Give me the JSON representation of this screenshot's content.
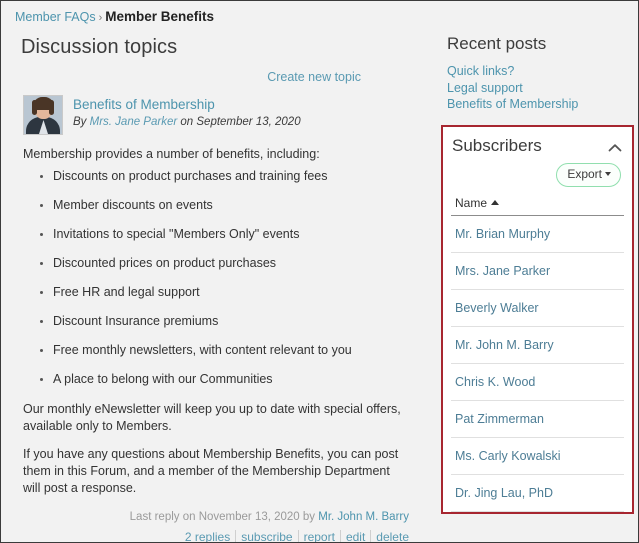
{
  "breadcrumb": {
    "parent": "Member FAQs",
    "separator": "›",
    "current": "Member Benefits"
  },
  "main": {
    "page_title": "Discussion topics",
    "create_topic_label": "Create new topic",
    "topic": {
      "title": "Benefits of Membership",
      "byline_prefix": "By",
      "author": "Mrs. Jane Parker",
      "byline_suffix": "on September 13, 2020",
      "intro": "Membership provides a number of benefits, including:",
      "benefits": [
        "Discounts on product purchases and training fees",
        "Member discounts on events",
        "Invitations to special \"Members Only\" events",
        "Discounted prices on product purchases",
        "Free HR and legal support",
        "Discount Insurance premiums",
        "Free monthly newsletters, with content relevant to you",
        "A place to belong with our Communities"
      ],
      "paragraph_2": "Our monthly eNewsletter will keep you up to date with special offers, available only to Members.",
      "paragraph_3": "If you have any questions about Membership Benefits, you can post them in this Forum, and a member of the Membership Department will post a response.",
      "last_reply_text": "Last reply on November 13, 2020 by",
      "last_reply_author": "Mr. John M. Barry",
      "actions": [
        "2 replies",
        "subscribe",
        "report",
        "edit",
        "delete"
      ]
    }
  },
  "sidebar": {
    "recent_posts": {
      "title": "Recent posts",
      "links": [
        "Quick links?",
        "Legal support",
        "Benefits of Membership"
      ]
    },
    "subscribers": {
      "title": "Subscribers",
      "collapse_icon": "chevron-up-icon",
      "export_label": "Export",
      "column_header": "Name",
      "sort_direction": "ascending",
      "names": [
        "Mr. Brian Murphy",
        "Mrs. Jane Parker",
        "Beverly Walker",
        "Mr. John M. Barry",
        "Chris K. Wood",
        "Pat Zimmerman",
        "Ms. Carly Kowalski",
        "Dr. Jing Lau, PhD"
      ]
    }
  },
  "colors": {
    "link": "#4d94ad",
    "highlight_border": "#a72630",
    "export_border": "#90dfae",
    "page_background": "#f2f2f2",
    "panel_background": "#ffffff"
  }
}
